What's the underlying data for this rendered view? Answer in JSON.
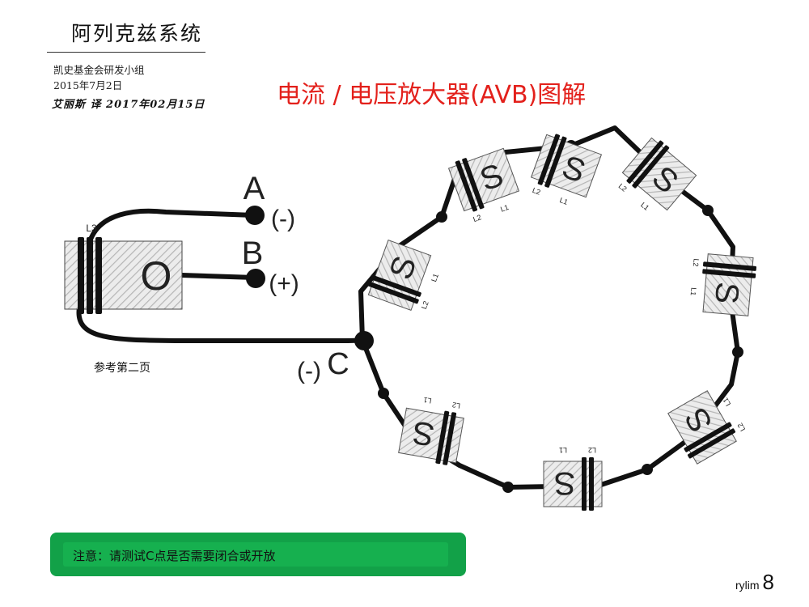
{
  "header": {
    "title": "阿列克兹系统",
    "org": "凯史基金会研发小组",
    "date": "2015年7月2日",
    "translator": "艾丽斯 译 2017年02月15日"
  },
  "heading": "电流 / 电压放大器(AVB)图解",
  "terminals": {
    "a_label": "A",
    "a_polarity": "(-)",
    "b_label": "B",
    "b_polarity": "(+)",
    "c_polarity": "(-)",
    "c_label": "C"
  },
  "core": {
    "coil_label": "L3",
    "core_label": "O"
  },
  "ring": {
    "core_label": "S",
    "coil1": "L1",
    "coil2": "L2"
  },
  "reference_note": "参考第二页",
  "note": "注意：请测试C点是否需要闭合或开放",
  "footer": {
    "brand": "rylim",
    "page": "8"
  }
}
